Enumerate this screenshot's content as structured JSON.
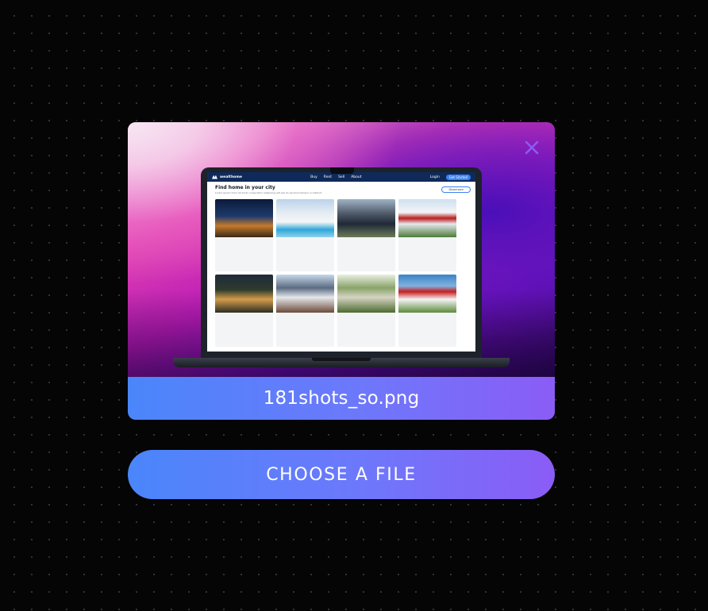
{
  "upload_card": {
    "file_name": "181shots_so.png",
    "close_icon": "close-icon"
  },
  "choose_button": {
    "label": "CHOOSE A FILE"
  },
  "colors": {
    "accent_start": "#4a86fb",
    "accent_end": "#8b5cf6",
    "close_icon": "#8b5cf6",
    "background": "#050505"
  },
  "preview_site": {
    "brand": "wealthome",
    "nav": [
      "Buy",
      "Rent",
      "Sell",
      "About"
    ],
    "login": "Login",
    "cta": "Get Started",
    "hero_title": "Find home in your city",
    "hero_sub": "Lorem ipsum dolor sit amet consectetur adipiscing elit sed do eiusmod tempor incididunt",
    "search_label": "Downtown"
  }
}
